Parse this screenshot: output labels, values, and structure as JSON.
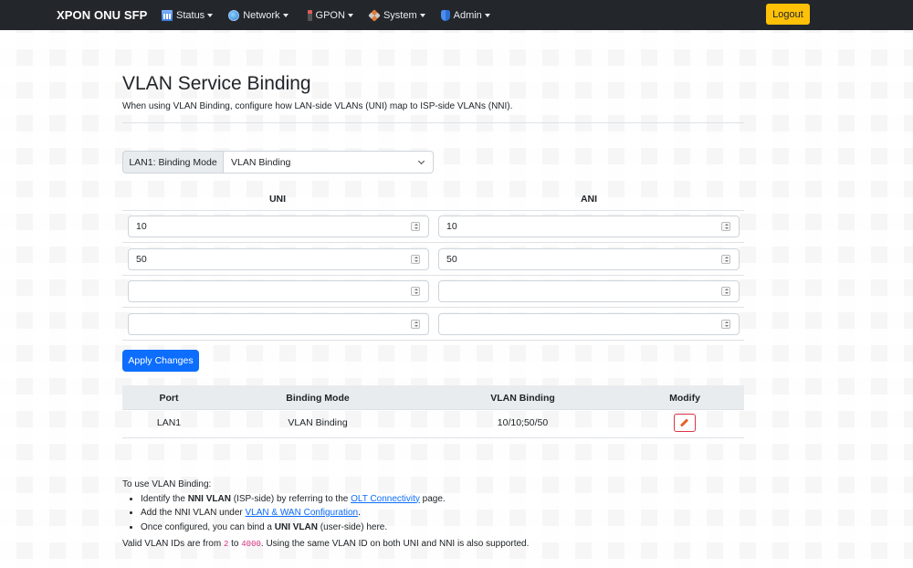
{
  "navbar": {
    "brand": "XPON ONU SFP",
    "items": [
      {
        "label": "Status",
        "icon": "status-chart-icon"
      },
      {
        "label": "Network",
        "icon": "globe-icon"
      },
      {
        "label": "GPON",
        "icon": "pin-icon"
      },
      {
        "label": "System",
        "icon": "tools-icon"
      },
      {
        "label": "Admin",
        "icon": "shield-icon"
      }
    ],
    "logout_label": "Logout"
  },
  "page": {
    "title": "VLAN Service Binding",
    "subtitle": "When using VLAN Binding, configure how LAN-side VLANs (UNI) map to ISP-side VLANs (NNI)."
  },
  "binding_mode": {
    "label": "LAN1: Binding Mode",
    "selected": "VLAN Binding"
  },
  "mapping": {
    "uni_header": "UNI",
    "ani_header": "ANI",
    "rows": [
      {
        "uni": "10",
        "ani": "10"
      },
      {
        "uni": "50",
        "ani": "50"
      },
      {
        "uni": "",
        "ani": ""
      },
      {
        "uni": "",
        "ani": ""
      }
    ]
  },
  "apply_label": "Apply Changes",
  "table": {
    "headers": [
      "Port",
      "Binding Mode",
      "VLAN Binding",
      "Modify"
    ],
    "rows": [
      {
        "port": "LAN1",
        "mode": "VLAN Binding",
        "binding": "10/10;50/50"
      }
    ]
  },
  "notes": {
    "intro": "To use VLAN Binding:",
    "b1_pre": "Identify the ",
    "b1_strong": "NNI VLAN",
    "b1_mid": " (ISP-side) by referring to the ",
    "b1_link": "OLT Connectivity",
    "b1_post": " page.",
    "b2_pre": "Add the NNI VLAN under ",
    "b2_link": "VLAN & WAN Configuration",
    "b2_post": ".",
    "b3_pre": "Once configured, you can bind a ",
    "b3_strong": "UNI VLAN",
    "b3_post": " (user-side) here.",
    "valid_pre": "Valid VLAN IDs are from ",
    "valid_min": "2",
    "valid_mid": " to ",
    "valid_max": "4000",
    "valid_post": ". Using the same VLAN ID on both UNI and NNI is also supported."
  },
  "colors": {
    "navbar_bg": "#23272b",
    "logout_bg": "#ffc107",
    "primary": "#0d6efd",
    "danger": "#dc3545"
  }
}
